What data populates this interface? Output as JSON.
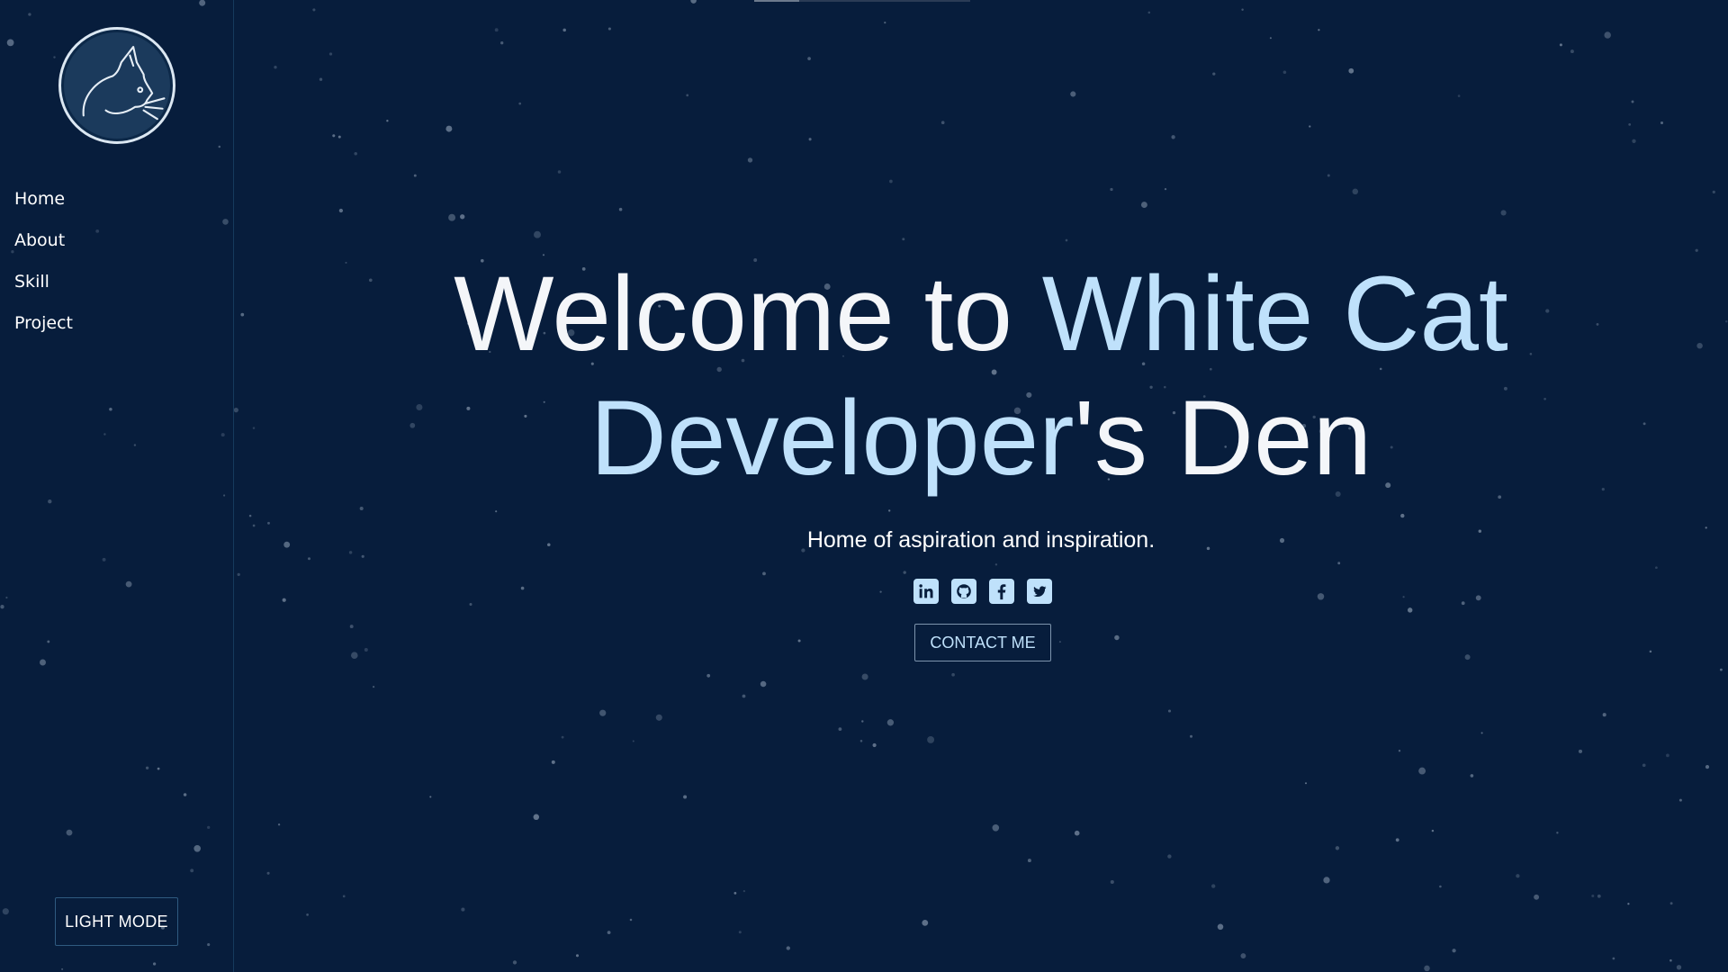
{
  "sidebar": {
    "logo_icon": "white-cat-logo-icon",
    "nav": [
      {
        "label": "Home"
      },
      {
        "label": "About"
      },
      {
        "label": "Skill"
      },
      {
        "label": "Project"
      }
    ],
    "theme_toggle_label": "LIGHT MODE"
  },
  "hero": {
    "title_part1": "Welcome to ",
    "title_highlight": "White Cat Developer",
    "title_part2": "'s Den",
    "subtitle": "Home of aspiration and inspiration.",
    "contact_label": "CONTACT ME",
    "socials": [
      {
        "icon": "linkedin-icon"
      },
      {
        "icon": "github-icon"
      },
      {
        "icon": "facebook-icon"
      },
      {
        "icon": "twitter-icon"
      }
    ]
  },
  "colors": {
    "background": "#071d3c",
    "accent": "#bfe1fb",
    "text": "#ffffff",
    "sidebar_border": "#163a5c"
  }
}
